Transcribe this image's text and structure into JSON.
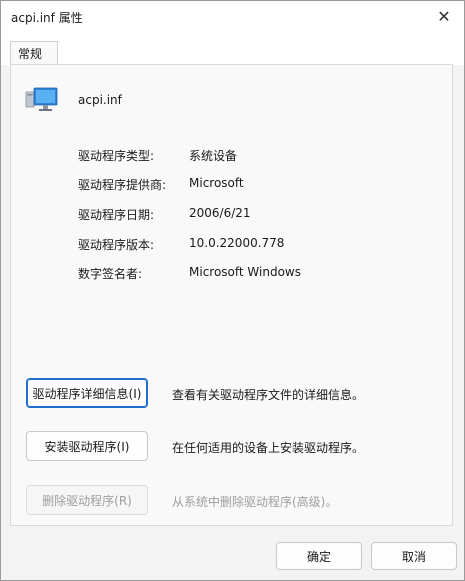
{
  "window": {
    "title": "acpi.inf 属性",
    "close_glyph": "✕"
  },
  "tabs": [
    {
      "label": "常规"
    }
  ],
  "driver": {
    "icon": "computer-device-icon",
    "name": "acpi.inf",
    "props": [
      {
        "label": "驱动程序类型:",
        "value": "系统设备"
      },
      {
        "label": "驱动程序提供商:",
        "value": "Microsoft"
      },
      {
        "label": "驱动程序日期:",
        "value": "2006/6/21"
      },
      {
        "label": "驱动程序版本:",
        "value": "10.0.22000.778"
      },
      {
        "label": "数字签名者:",
        "value": "Microsoft Windows"
      }
    ]
  },
  "actions": [
    {
      "label": "驱动程序详细信息(I)",
      "desc": "查看有关驱动程序文件的详细信息。",
      "state": "focused"
    },
    {
      "label": "安装驱动程序(I)",
      "desc": "在任何适用的设备上安装驱动程序。",
      "state": "normal"
    },
    {
      "label": "删除驱动程序(R)",
      "desc": "从系统中删除驱动程序(高级)。",
      "state": "disabled"
    }
  ],
  "footer": {
    "ok_label": "确定",
    "cancel_label": "取消"
  },
  "colors": {
    "focus_border": "#1f6fcf",
    "monitor_blue": "#2f86d8",
    "disabled_text": "#9e9e9e"
  }
}
